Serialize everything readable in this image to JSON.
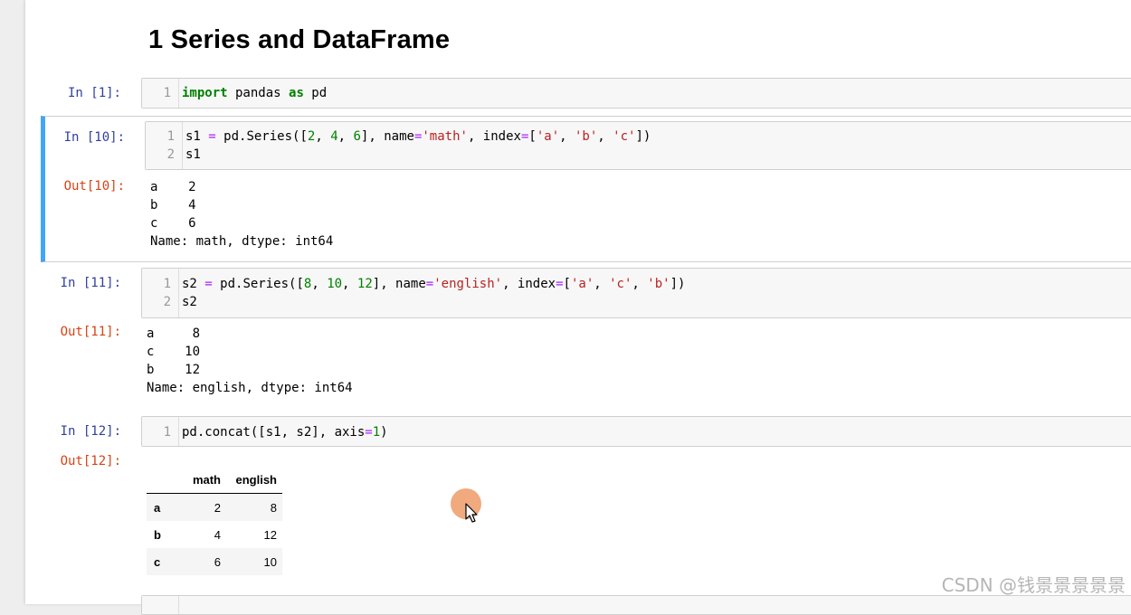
{
  "heading": "1  Series and DataFrame",
  "cells": [
    {
      "in_prompt": "In  [1]:",
      "lines": [
        {
          "num": "1",
          "parts": [
            [
              "kw",
              "import"
            ],
            [
              "",
              " pandas "
            ],
            [
              "kw",
              "as"
            ],
            [
              "",
              " pd"
            ]
          ]
        }
      ]
    },
    {
      "in_prompt": "In  [10]:",
      "out_prompt": "Out[10]:",
      "lines": [
        {
          "num": "1",
          "parts": [
            [
              "",
              "s1 "
            ],
            [
              "op",
              "="
            ],
            [
              "",
              " pd.Series(["
            ],
            [
              "num",
              "2"
            ],
            [
              "",
              ", "
            ],
            [
              "num",
              "4"
            ],
            [
              "",
              ", "
            ],
            [
              "num",
              "6"
            ],
            [
              "",
              "], name"
            ],
            [
              "op",
              "="
            ],
            [
              "str",
              "'math'"
            ],
            [
              "",
              ", index"
            ],
            [
              "op",
              "="
            ],
            [
              "",
              "["
            ],
            [
              "str",
              "'a'"
            ],
            [
              "",
              ", "
            ],
            [
              "str",
              "'b'"
            ],
            [
              "",
              ", "
            ],
            [
              "str",
              "'c'"
            ],
            [
              "",
              "])"
            ]
          ]
        },
        {
          "num": "2",
          "parts": [
            [
              "",
              "s1"
            ]
          ]
        }
      ],
      "output": [
        "a    2",
        "b    4",
        "c    6",
        "Name: math, dtype: int64"
      ]
    },
    {
      "in_prompt": "In  [11]:",
      "out_prompt": "Out[11]:",
      "lines": [
        {
          "num": "1",
          "parts": [
            [
              "",
              "s2 "
            ],
            [
              "op",
              "="
            ],
            [
              "",
              " pd.Series(["
            ],
            [
              "num",
              "8"
            ],
            [
              "",
              ", "
            ],
            [
              "num",
              "10"
            ],
            [
              "",
              ", "
            ],
            [
              "num",
              "12"
            ],
            [
              "",
              "], name"
            ],
            [
              "op",
              "="
            ],
            [
              "str",
              "'english'"
            ],
            [
              "",
              ", index"
            ],
            [
              "op",
              "="
            ],
            [
              "",
              "["
            ],
            [
              "str",
              "'a'"
            ],
            [
              "",
              ", "
            ],
            [
              "str",
              "'c'"
            ],
            [
              "",
              ", "
            ],
            [
              "str",
              "'b'"
            ],
            [
              "",
              "])"
            ]
          ]
        },
        {
          "num": "2",
          "parts": [
            [
              "",
              "s2"
            ]
          ]
        }
      ],
      "output": [
        "a     8",
        "c    10",
        "b    12",
        "Name: english, dtype: int64"
      ]
    },
    {
      "in_prompt": "In  [12]:",
      "out_prompt": "Out[12]:",
      "lines": [
        {
          "num": "1",
          "parts": [
            [
              "",
              "pd.concat([s1, s2], axis"
            ],
            [
              "op",
              "="
            ],
            [
              "num",
              "1"
            ],
            [
              "",
              ")"
            ]
          ]
        }
      ],
      "table": {
        "columns": [
          "",
          "math",
          "english"
        ],
        "rows": [
          [
            "a",
            "2",
            "8"
          ],
          [
            "b",
            "4",
            "12"
          ],
          [
            "c",
            "6",
            "10"
          ]
        ]
      }
    }
  ],
  "watermark": "CSDN @钱景景景景景",
  "colors": {
    "selected_bar": "#42a5f5",
    "in_prompt": "#303f9f",
    "out_prompt": "#d84315",
    "keyword": "#008000",
    "string": "#ba2121",
    "operator": "#aa22ff"
  }
}
